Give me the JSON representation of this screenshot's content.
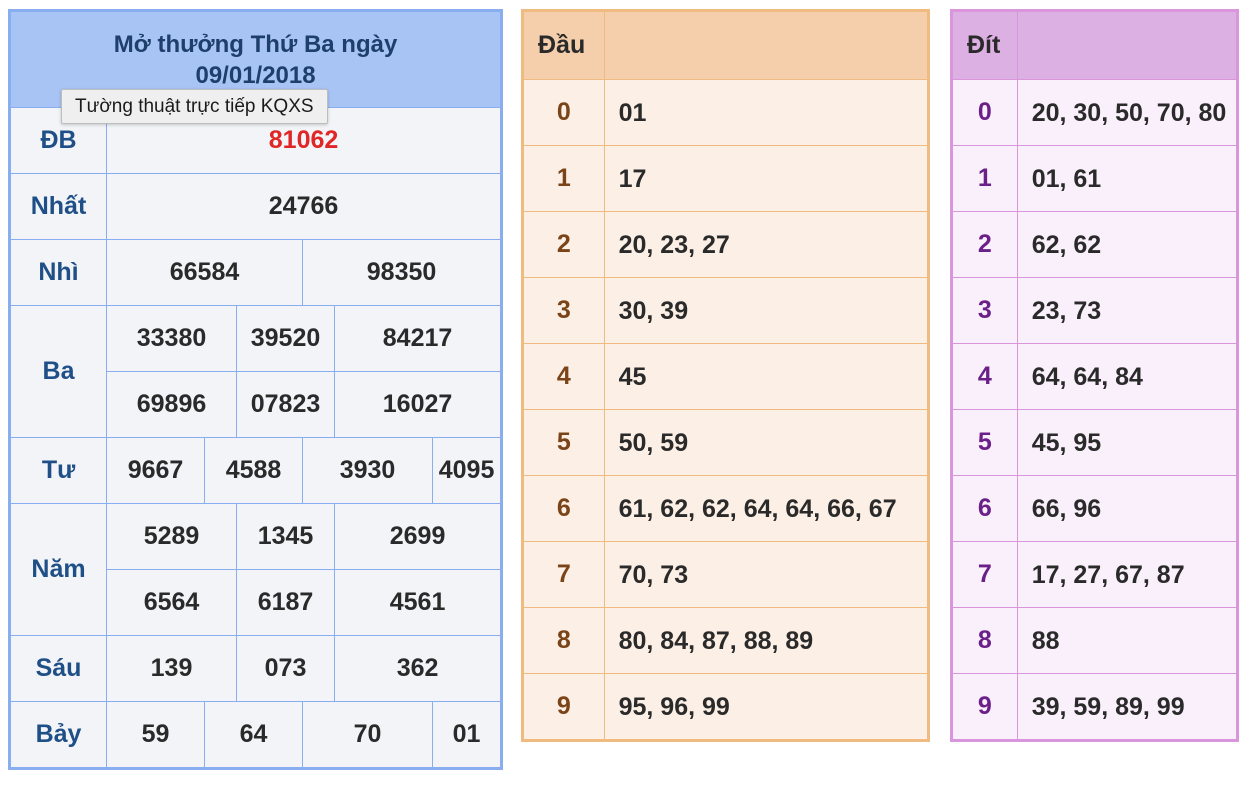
{
  "results": {
    "title_line1": "Mở thưởng Thứ Ba ngày",
    "title_line2": "09/01/2018",
    "db_label": "ĐB",
    "db": "81062",
    "nhat_label": "Nhất",
    "nhat": "24766",
    "nhi_label": "Nhì",
    "nhi": [
      "66584",
      "98350"
    ],
    "ba_label": "Ba",
    "ba_row1": [
      "33380",
      "39520",
      "84217"
    ],
    "ba_row2": [
      "69896",
      "07823",
      "16027"
    ],
    "tu_label": "Tư",
    "tu": [
      "9667",
      "4588",
      "3930",
      "4095"
    ],
    "nam_label": "Năm",
    "nam_row1": [
      "5289",
      "1345",
      "2699"
    ],
    "nam_row2": [
      "6564",
      "6187",
      "4561"
    ],
    "sau_label": "Sáu",
    "sau": [
      "139",
      "073",
      "362"
    ],
    "bay_label": "Bảy",
    "bay": [
      "59",
      "64",
      "70",
      "01"
    ]
  },
  "tooltip": "Tường thuật trực tiếp KQXS",
  "dau": {
    "header": "Đầu",
    "rows": [
      {
        "key": "0",
        "values": "01"
      },
      {
        "key": "1",
        "values": "17"
      },
      {
        "key": "2",
        "values": "20, 23, 27"
      },
      {
        "key": "3",
        "values": "30, 39"
      },
      {
        "key": "4",
        "values": "45"
      },
      {
        "key": "5",
        "values": "50, 59"
      },
      {
        "key": "6",
        "values": "61, 62, 62, 64, 64, 66, 67"
      },
      {
        "key": "7",
        "values": "70, 73"
      },
      {
        "key": "8",
        "values": "80, 84, 87, 88, 89"
      },
      {
        "key": "9",
        "values": "95, 96, 99"
      }
    ]
  },
  "dit": {
    "header": "Đít",
    "rows": [
      {
        "key": "0",
        "values": "20, 30, 50, 70, 80"
      },
      {
        "key": "1",
        "values": "01, 61"
      },
      {
        "key": "2",
        "values": "62, 62"
      },
      {
        "key": "3",
        "values": "23, 73"
      },
      {
        "key": "4",
        "values": "64, 64, 84"
      },
      {
        "key": "5",
        "values": "45, 95"
      },
      {
        "key": "6",
        "values": "66, 96"
      },
      {
        "key": "7",
        "values": "17, 27, 67, 87"
      },
      {
        "key": "8",
        "values": "88"
      },
      {
        "key": "9",
        "values": "39, 59, 89, 99"
      }
    ]
  }
}
